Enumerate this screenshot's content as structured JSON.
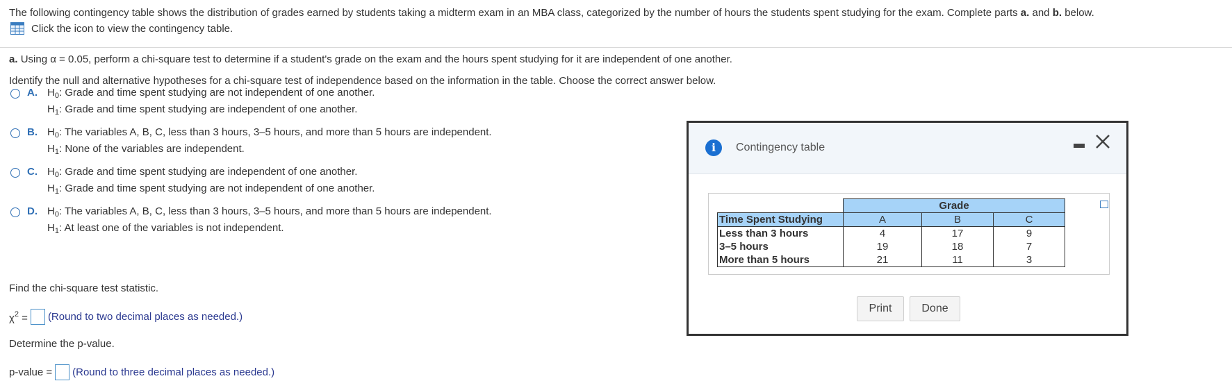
{
  "intro": {
    "text_before": "The following contingency table shows the distribution of grades earned by students taking a midterm exam in an MBA class, categorized by the number of hours the students spent studying for the exam. Complete parts ",
    "bold_a": "a.",
    "text_and": " and ",
    "bold_b": "b.",
    "text_after": " below.",
    "icon_link": "Click the icon to view the contingency table."
  },
  "part_a": {
    "label": "a.",
    "text": "Using α = 0.05, perform a chi-square test to determine if a student's grade on the exam and the hours spent studying for it are independent of one another."
  },
  "identify": "Identify the null and alternative hypotheses for a chi-square test of independence based on the information in the table. Choose the correct answer below.",
  "options": [
    {
      "letter": "A.",
      "h0": "Grade and time spent studying are not independent of one another.",
      "h1": "Grade and time spent studying are independent of one another."
    },
    {
      "letter": "B.",
      "h0": "The variables A, B, C, less than 3 hours, 3–5 hours, and more than 5 hours are independent.",
      "h1": "None of the variables are independent."
    },
    {
      "letter": "C.",
      "h0": "Grade and time spent studying are independent of one another.",
      "h1": "Grade and time spent studying are not independent of one another."
    },
    {
      "letter": "D.",
      "h0": "The variables A, B, C, less than 3 hours, 3–5 hours, and more than 5 hours are independent.",
      "h1": "At least one of the variables is not independent."
    }
  ],
  "h0_label": "H",
  "h0_sub": "0",
  "h1_sub": "1",
  "find_stat": "Find the chi-square test statistic.",
  "chi": {
    "symbol": "χ",
    "sup": "2",
    "eq": " =",
    "hint": "(Round to two decimal places as needed.)"
  },
  "pvalue_label": "Determine the p-value.",
  "pvalue": {
    "label": "p-value =",
    "hint": "(Round to three decimal places as needed.)"
  },
  "modal": {
    "title": "Contingency table",
    "print": "Print",
    "done": "Done",
    "table": {
      "group_header": "Grade",
      "row_header": "Time Spent Studying",
      "columns": [
        "A",
        "B",
        "C"
      ],
      "rows": [
        {
          "label": "Less than 3 hours",
          "values": [
            "4",
            "17",
            "9"
          ]
        },
        {
          "label": "3–5 hours",
          "values": [
            "19",
            "18",
            "7"
          ]
        },
        {
          "label": "More than 5 hours",
          "values": [
            "21",
            "11",
            "3"
          ]
        }
      ]
    }
  },
  "colors": {
    "accent": "#2f6fb5",
    "header_fill": "#a6d3f8",
    "hint": "#2b3990"
  }
}
